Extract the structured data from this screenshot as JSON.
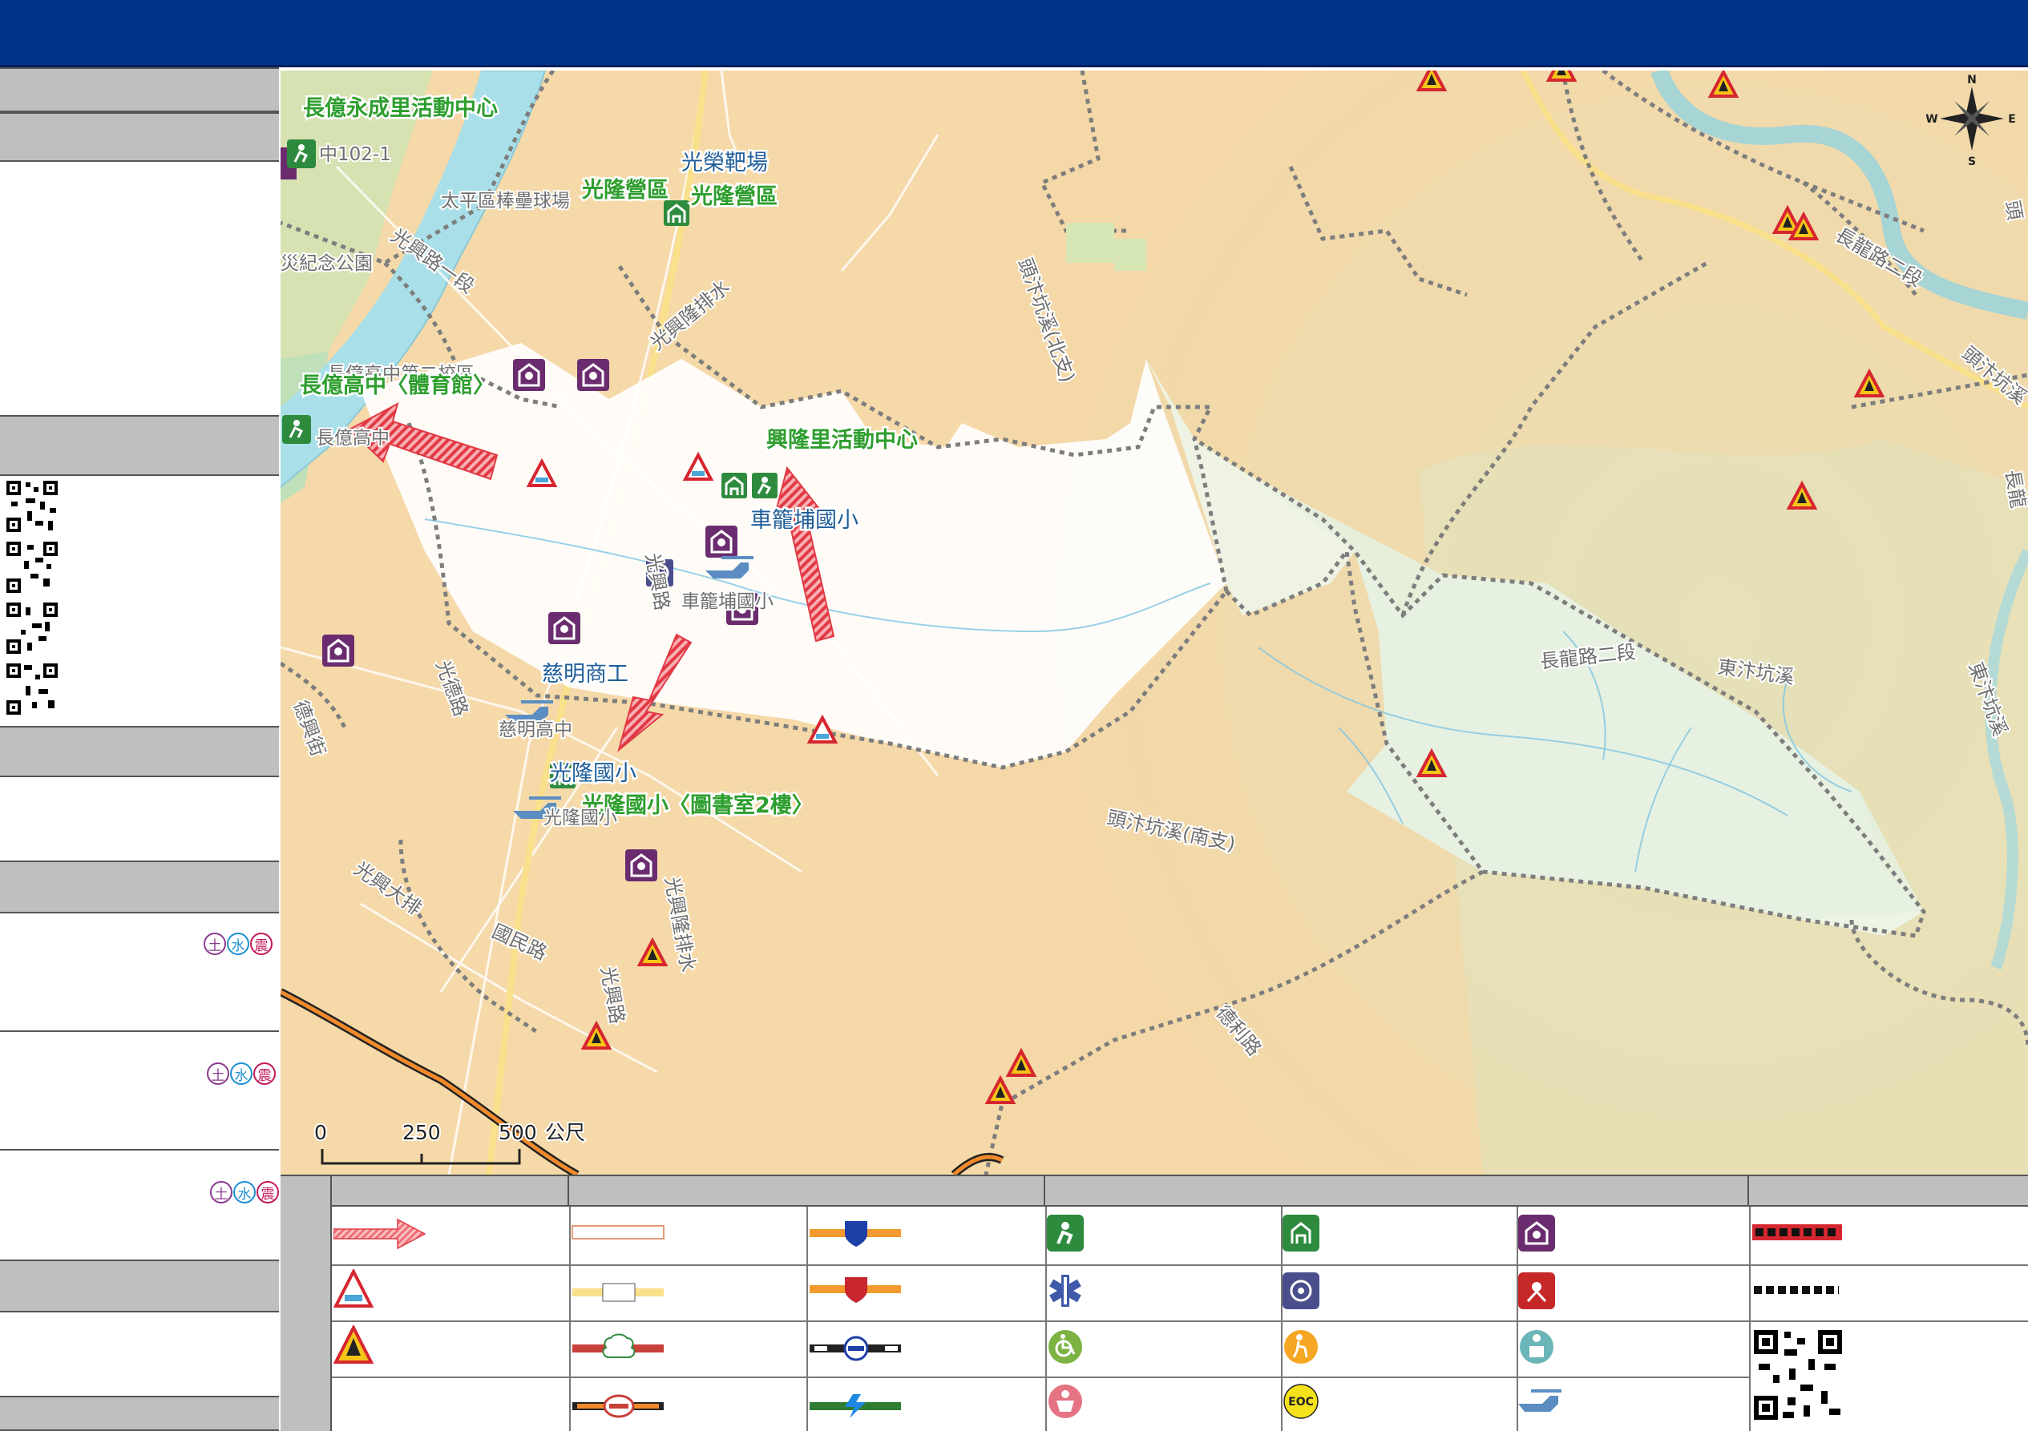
{
  "header": {
    "title": ""
  },
  "map": {
    "labels": {
      "yongcheng_center": "長億永成里活動中心",
      "road_zhong102": "中102-1",
      "guangrong_range": "光榮靶場",
      "guanglong_camp_a": "光隆營區",
      "guanglong_camp_b": "光隆營區",
      "taiping_field": "太平區棒壘球場",
      "memorial_park": "災紀念公園",
      "guangxing_ditch": "光興隆排水",
      "changyi_campus2": "長億高中第二校區",
      "changyi_gym": "長億高中〈體育館〉",
      "changyi_hs": "長億高中",
      "xinglong_center": "興隆里活動中心",
      "chelongpu_label": "車籠埔國小",
      "chelongpu_gray": "車籠埔國小",
      "ciming_vocational": "慈明商工",
      "ciming_hs": "慈明高中",
      "guanglong_es": "光隆國小",
      "guanglong_es_library": "光隆國小〈圖書室2樓〉",
      "guanglong_gray": "光隆國小",
      "guangxing_road": "光興路",
      "guangxing_road2": "光興路",
      "guangde_road": "光德路",
      "dexing_st": "德興街",
      "guomin_road": "國民路",
      "tou_bian_keng_n": "頭汴坑溪(北支)",
      "tou_bian_keng_s": "頭汴坑溪(南支)",
      "changlong_road2_a": "長龍路二段",
      "changlong_road2_b": "長龍路二段",
      "dongbian_keng_a": "東汴坑溪",
      "dongbian_keng_b": "東汴坑溪",
      "touku_keng": "頭汴坑溪",
      "changlong_edge": "長龍",
      "deli_road": "德利路",
      "tou_edge": "頭",
      "guangxing_ditch2": "光興隆排水",
      "shadow_road_a": "光興大排",
      "shadow_road_b": "光興路一段"
    },
    "compass": {
      "n": "N",
      "s": "S",
      "e": "E",
      "w": "W"
    },
    "scale": {
      "ticks": [
        "0",
        "250",
        "500"
      ],
      "unit": "公尺"
    }
  },
  "sidebar": {
    "hazard_badges": [
      "土",
      "水",
      "震"
    ]
  },
  "legend": {
    "eoc_label": "EOC"
  },
  "colors": {
    "header": "#00338a",
    "panel_gray": "#bfbfbf",
    "terrain": "#f4d9a8",
    "river": "#a9dfe8",
    "zone_white": "#ffffff",
    "zone_green": "#e9f3e1",
    "shelter_purple": "#6b2c6f",
    "evac_green": "#2e8b3e",
    "evac_arrow": "#e8474f"
  }
}
